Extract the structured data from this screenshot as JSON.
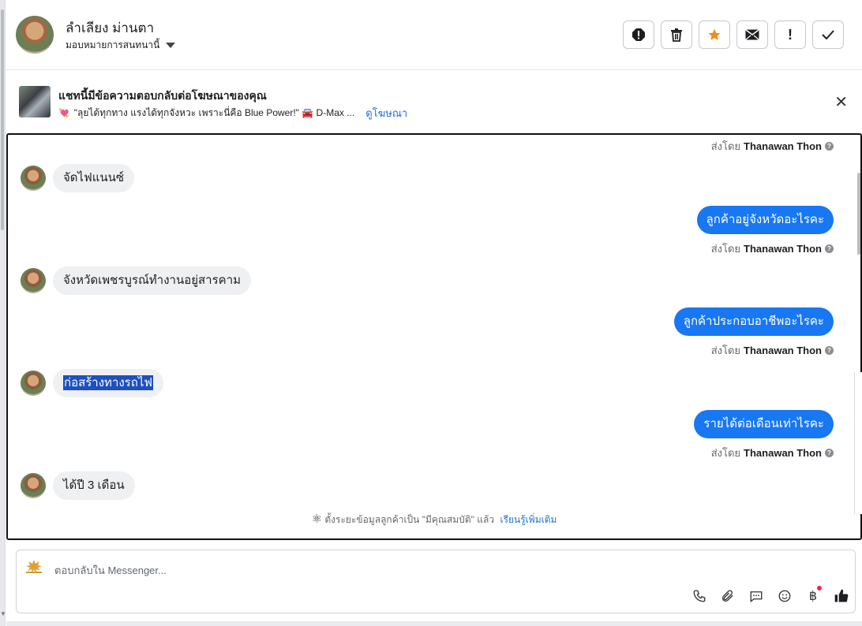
{
  "header": {
    "contact_name": "ลำเลียง ม่านตา",
    "assign_label": "มอบหมายการสนทนานี้",
    "actions": [
      {
        "name": "spam-icon",
        "glyph": "!"
      },
      {
        "name": "trash-icon",
        "glyph": "🗑"
      },
      {
        "name": "star-icon",
        "glyph": "★"
      },
      {
        "name": "mail-icon",
        "glyph": "✉"
      },
      {
        "name": "follow-up-icon",
        "glyph": "!"
      },
      {
        "name": "done-check-icon",
        "glyph": "✓"
      }
    ]
  },
  "banner": {
    "title": "แชทนี้มีข้อความตอบกลับต่อโฆษณาของคุณ",
    "subtitle": "\"ลุยได้ทุกทาง แรงได้ทุกจังหวะ เพราะนี่คือ Blue Power!\" 🚘 D-Max ...",
    "link": "ดูโฆษณา",
    "close": "✕"
  },
  "messages": [
    {
      "dir": "out-meta",
      "sent_prefix": "ส่งโดย",
      "agent": "Thanawan Thon"
    },
    {
      "dir": "in",
      "text": "จัดไฟแนนซ์"
    },
    {
      "dir": "out",
      "text": "ลูกค้าอยู่จังหวัดอะไรคะ",
      "sent_prefix": "ส่งโดย",
      "agent": "Thanawan Thon"
    },
    {
      "dir": "in",
      "text": "จังหวัดเพชรบูรณ์ทำงานอยู่สารคาม"
    },
    {
      "dir": "out",
      "text": "ลูกค้าประกอบอาชีพอะไรคะ",
      "sent_prefix": "ส่งโดย",
      "agent": "Thanawan Thon"
    },
    {
      "dir": "in",
      "text": "ก่อสร้างทางรถไฟ",
      "selected": true
    },
    {
      "dir": "out",
      "text": "รายได้ต่อเดือนเท่าไรคะ",
      "sent_prefix": "ส่งโดย",
      "agent": "Thanawan Thon"
    },
    {
      "dir": "in",
      "text": "ได้ปี 3 เดือน"
    }
  ],
  "notice": {
    "text": "ตั้งระยะข้อมูลลูกค้าเป็น \"มีคุณสมบัติ\" แล้ว",
    "link": "เรียนรู้เพิ่มเติม"
  },
  "composer": {
    "placeholder": "ตอบกลับใน Messenger...",
    "tools": [
      "phone-icon",
      "attach-icon",
      "saved-reply-icon",
      "emoji-icon",
      "payment-baht-icon",
      "like-icon"
    ]
  }
}
